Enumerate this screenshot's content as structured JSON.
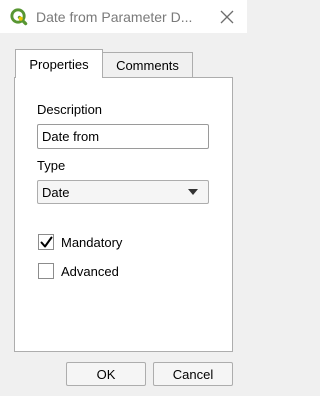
{
  "window": {
    "title": "Date from Parameter D...",
    "app_icon": "qgis-logo-icon",
    "close_icon": "close-icon"
  },
  "tabs": [
    {
      "label": "Properties",
      "active": true
    },
    {
      "label": "Comments",
      "active": false
    }
  ],
  "properties": {
    "description_label": "Description",
    "description_value": "Date from",
    "type_label": "Type",
    "type_value": "Date",
    "mandatory_label": "Mandatory",
    "mandatory_checked": true,
    "advanced_label": "Advanced",
    "advanced_checked": false
  },
  "buttons": {
    "ok": "OK",
    "cancel": "Cancel"
  },
  "colors": {
    "qgis_green": "#589632",
    "qgis_yellow": "#f0c800"
  }
}
